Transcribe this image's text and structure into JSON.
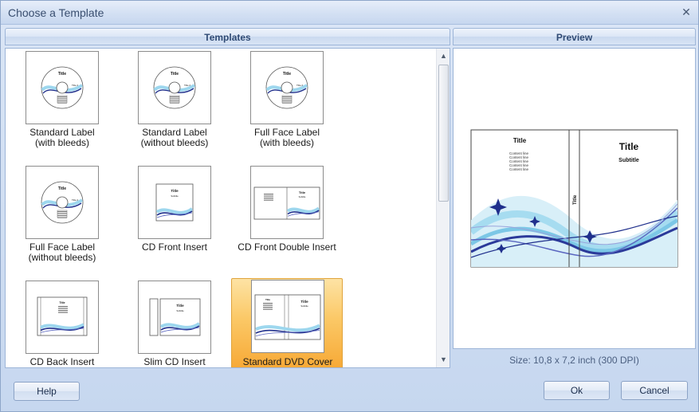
{
  "window": {
    "title": "Choose a Template",
    "close_glyph": "✕"
  },
  "templates_panel": {
    "header": "Templates",
    "items": [
      {
        "label": "Standard Label\n(with bleeds)",
        "kind": "disc"
      },
      {
        "label": "Standard Label\n(without bleeds)",
        "kind": "disc"
      },
      {
        "label": "Full Face Label\n(with bleeds)",
        "kind": "disc"
      },
      {
        "label": "Full Face Label\n(without bleeds)",
        "kind": "disc"
      },
      {
        "label": "CD Front Insert",
        "kind": "front"
      },
      {
        "label": "CD Front Double Insert",
        "kind": "double"
      },
      {
        "label": "CD Back Insert",
        "kind": "back"
      },
      {
        "label": "Slim CD Insert",
        "kind": "slim"
      },
      {
        "label": "Standard DVD Cover",
        "kind": "dvd",
        "selected": true
      }
    ],
    "thumb_text": {
      "title": "Title",
      "title2": "Title 2",
      "subtitle": "Subtitle"
    }
  },
  "preview_panel": {
    "header": "Preview",
    "title": "Title",
    "subtitle": "Subtitle",
    "spine_title": "Title",
    "content_lines": [
      "Content line",
      "Content line",
      "Content line",
      "Content line",
      "Content line"
    ],
    "size_text": "Size: 10,8 x 7,2 inch (300 DPI)"
  },
  "buttons": {
    "help": "Help",
    "ok": "Ok",
    "cancel": "Cancel"
  },
  "colors": {
    "accent_blue": "#1f2f8c",
    "wave_light": "#9dd7ee",
    "selection": "#fbc866"
  }
}
